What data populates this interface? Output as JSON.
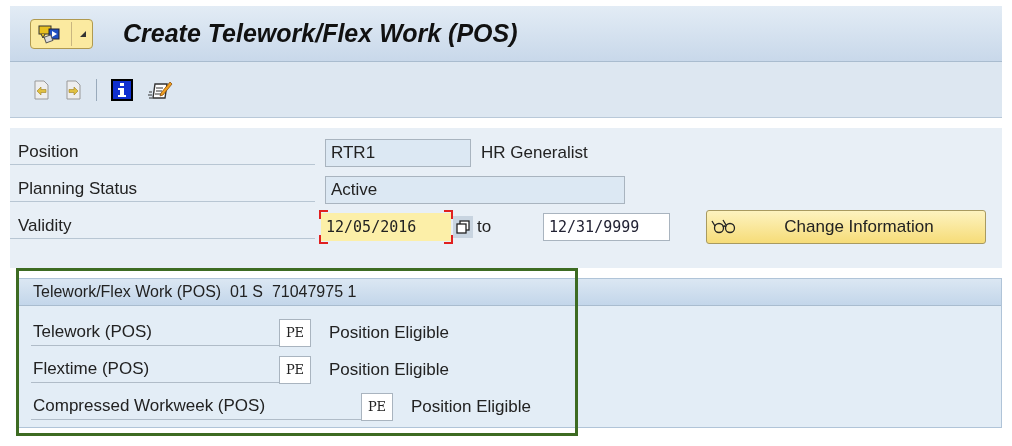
{
  "window": {
    "title": "Create Telework/Flex Work (POS)"
  },
  "form": {
    "position": {
      "label": "Position",
      "value": "RTR1",
      "text": "HR Generalist"
    },
    "planning_status": {
      "label": "Planning Status",
      "value": "Active"
    },
    "validity": {
      "label": "Validity",
      "from": "12/05/2016",
      "from_focused": true,
      "separator": "to",
      "to": "12/31/9999"
    },
    "change_button": "Change Information"
  },
  "group": {
    "title": "Telework/Flex Work (POS)  01 S  71047975 1",
    "highlighted": true,
    "rows": [
      {
        "label": "Telework (POS)",
        "code": "PE",
        "text": "Position Eligible"
      },
      {
        "label": "Flextime (POS)",
        "code": "PE",
        "text": "Position Eligible"
      },
      {
        "label": "Compressed Workweek (POS)",
        "code": "PE",
        "text": "Position Eligible"
      }
    ]
  }
}
